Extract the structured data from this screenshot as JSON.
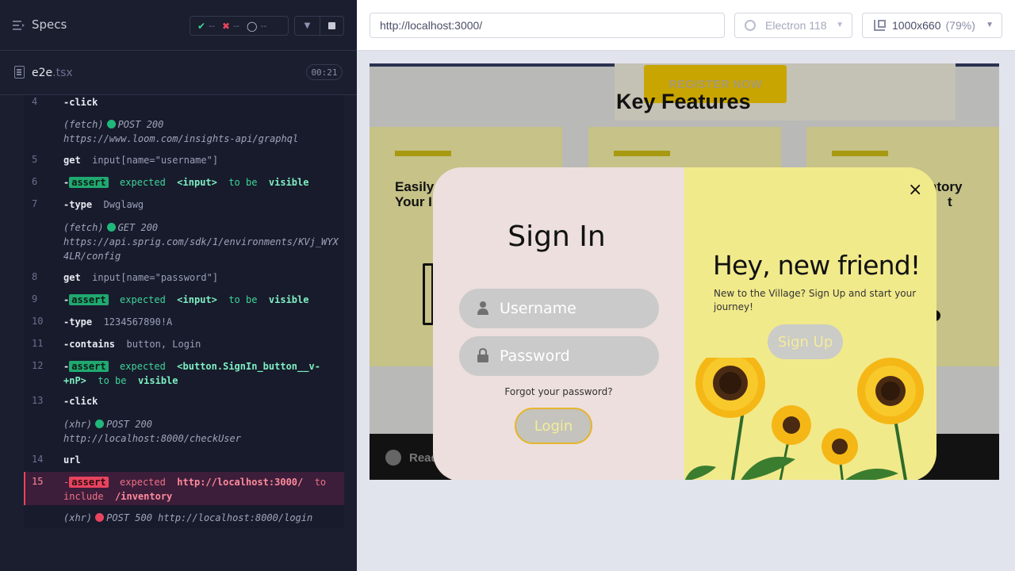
{
  "specs": {
    "title": "Specs",
    "passed": "--",
    "failed": "--",
    "pending": "--"
  },
  "file": {
    "name": "e2e",
    "ext": ".tsx",
    "duration": "00:21"
  },
  "log": [
    {
      "ln": "4",
      "cmd": "-click"
    },
    {
      "prefix": "(fetch)",
      "status": "POST 200",
      "url": "https://www.loom.com/insights-api/graphql"
    },
    {
      "ln": "5",
      "cmd": "get",
      "arg": "input[name=\"username\"]"
    },
    {
      "ln": "6",
      "badge": "assert",
      "t1": "expected",
      "t2": "<input>",
      "t3": "to be",
      "t4": "visible"
    },
    {
      "ln": "7",
      "cmd": "-type",
      "arg": "Dwglawg"
    },
    {
      "prefix": "(fetch)",
      "status": "GET 200",
      "url1": "https://api.sprig.com/sdk/1/environments/KVj_WYX",
      "url2": "4LR/config"
    },
    {
      "ln": "8",
      "cmd": "get",
      "arg": "input[name=\"password\"]"
    },
    {
      "ln": "9",
      "badge": "assert",
      "t1": "expected",
      "t2": "<input>",
      "t3": "to be",
      "t4": "visible"
    },
    {
      "ln": "10",
      "cmd": "-type",
      "arg": "1234567890!A"
    },
    {
      "ln": "11",
      "cmd": "-contains",
      "arg": "button, Login"
    },
    {
      "ln": "12",
      "badge": "assert",
      "t1": "expected",
      "t2": "<button.SignIn_button__v-",
      "t2b": "+nP>",
      "t3": "to be",
      "t4": "visible"
    },
    {
      "ln": "13",
      "cmd": "-click"
    },
    {
      "prefix": "(xhr)",
      "status": "POST 200",
      "url": "http://localhost:8000/checkUser"
    },
    {
      "ln": "14",
      "cmd": "url"
    },
    {
      "ln": "15",
      "badge": "assert",
      "t1": "expected",
      "t2": "http://localhost:3000/",
      "t3": "to",
      "t3b": "include",
      "t4": "/inventory"
    },
    {
      "prefix": "(xhr)",
      "status": "POST 500",
      "url": "http://localhost:8000/login"
    }
  ],
  "topbar": {
    "url": "http://localhost:3000/",
    "browser": "Electron 118",
    "viewport": "1000x660",
    "zoom": "(79%)"
  },
  "app": {
    "register_label": "REGISTER NOW",
    "features_title": "Key Features",
    "feature1_line1": "Easily",
    "feature1_line2": "Your I",
    "feature3_line1": "ntory",
    "feature3_line2": "t",
    "bottom_text": "Read"
  },
  "modal": {
    "signin_title": "Sign In",
    "username_placeholder": "Username",
    "password_placeholder": "Password",
    "forgot": "Forgot your password?",
    "login_label": "Login",
    "close_label": "×",
    "hey_title": "Hey, new friend!",
    "hey_sub": "New to the Village? Sign Up and start your journey!",
    "signup_label": "Sign Up"
  },
  "colors": {
    "pass": "#1fa971",
    "fail": "#e8445e",
    "modal_left": "#ecdfdd",
    "modal_right": "#f1ea8b"
  },
  "icons": [
    "specs-list-icon",
    "check-icon",
    "x-icon",
    "spinner-icon",
    "chevron-down-icon",
    "stop-icon",
    "file-icon",
    "browser-icon",
    "viewport-icon",
    "user-icon",
    "lock-icon",
    "close-icon"
  ]
}
